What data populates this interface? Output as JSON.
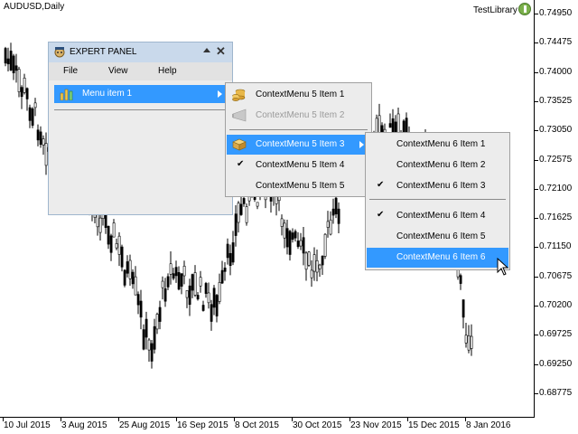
{
  "chart": {
    "symbol_title": "AUDUSD,Daily",
    "library_label": "TestLibrary",
    "price_labels": [
      "0.74950",
      "0.74475",
      "0.74000",
      "0.73525",
      "0.73050",
      "0.72575",
      "0.72100",
      "0.71625",
      "0.71150",
      "0.70675",
      "0.70200",
      "0.69725",
      "0.69250",
      "0.68775"
    ],
    "date_labels": [
      "10 Jul 2015",
      "3 Aug 2015",
      "25 Aug 2015",
      "16 Sep 2015",
      "8 Oct 2015",
      "30 Oct 2015",
      "23 Nov 2015",
      "15 Dec 2015",
      "8 Jan 2016"
    ],
    "colors": {
      "candle": "#000000",
      "background": "#ffffff"
    }
  },
  "panel": {
    "title": "EXPERT PANEL",
    "icon": "expert-hat-icon",
    "menubar": [
      "File",
      "View",
      "Help"
    ],
    "menu_item": {
      "label": "Menu item 1",
      "icon": "chart-bars-icon"
    },
    "colors": {
      "header": "#c9d9eb",
      "body": "#ececec",
      "highlight": "#3399ff"
    }
  },
  "context_menu_5": {
    "items": [
      {
        "label": "ContextMenu 5 Item 1",
        "icon": "coins-icon",
        "state": "normal"
      },
      {
        "label": "ContextMenu 5 Item 2",
        "icon": "funnel-icon",
        "state": "disabled"
      },
      {
        "label": "ContextMenu 5 Item 3",
        "icon": "box-icon",
        "state": "active",
        "submenu": true
      },
      {
        "label": "ContextMenu 5 Item 4",
        "icon": "check-icon",
        "state": "checked"
      },
      {
        "label": "ContextMenu 5 Item 5",
        "icon": "",
        "state": "normal"
      }
    ]
  },
  "context_menu_6": {
    "items": [
      {
        "label": "ContextMenu 6 Item 1",
        "state": "normal"
      },
      {
        "label": "ContextMenu 6 Item 2",
        "state": "normal"
      },
      {
        "label": "ContextMenu 6 Item 3",
        "state": "checked"
      },
      {
        "label": "ContextMenu 6 Item 4",
        "state": "checked"
      },
      {
        "label": "ContextMenu 6 Item 5",
        "state": "normal"
      },
      {
        "label": "ContextMenu 6 Item 6",
        "state": "active"
      }
    ]
  }
}
